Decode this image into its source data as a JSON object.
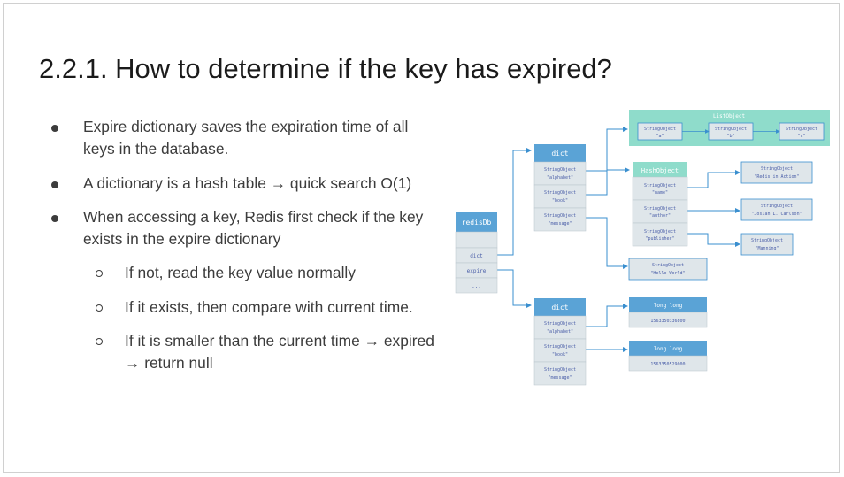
{
  "slide": {
    "title": "2.2.1. How to determine if the key has expired?"
  },
  "bullets": [
    {
      "level": 1,
      "lines": [
        "Expire dictionary saves the expiration time of all",
        "keys in the database."
      ]
    },
    {
      "level": 1,
      "lines": [
        "A dictionary is a hash table → quick search O(1)"
      ]
    },
    {
      "level": 1,
      "lines": [
        "When accessing a key, Redis first check if the key",
        "exists in the expire dictionary"
      ]
    },
    {
      "level": 2,
      "lines": [
        "If not, read the key value normally"
      ]
    },
    {
      "level": 2,
      "lines": [
        "If it exists, then compare with current time."
      ]
    },
    {
      "level": 2,
      "lines": [
        "If it is smaller than the current time → expired",
        "→ return null"
      ]
    }
  ],
  "diagram": {
    "redisDb": {
      "header": "redisDb",
      "cells": [
        "...",
        "dict",
        "expire",
        "..."
      ]
    },
    "dict_main": {
      "header": "dict",
      "cells": [
        [
          "StringObject",
          "\"alphabet\""
        ],
        [
          "StringObject",
          "\"book\""
        ],
        [
          "StringObject",
          "\"message\""
        ]
      ]
    },
    "dict_expire": {
      "header": "dict",
      "cells": [
        [
          "StringObject",
          "\"alphabet\""
        ],
        [
          "StringObject",
          "\"book\""
        ],
        [
          "StringObject",
          "\"message\""
        ]
      ]
    },
    "list_object": {
      "header": "ListObject",
      "items": [
        [
          "StringObject",
          "\"a\""
        ],
        [
          "StringObject",
          "\"b\""
        ],
        [
          "StringObject",
          "\"c\""
        ]
      ]
    },
    "hash_object": {
      "header": "HashObject",
      "cells": [
        [
          "StringObject",
          "\"name\""
        ],
        [
          "StringObject",
          "\"author\""
        ],
        [
          "StringObject",
          "\"publisher\""
        ]
      ]
    },
    "hash_values": [
      [
        "StringObject",
        "\"Redis in Action\""
      ],
      [
        "StringObject",
        "\"Josiah L. Carlson\""
      ],
      [
        "StringObject",
        "\"Manning\""
      ]
    ],
    "string_value": [
      "StringObject",
      "\"Hello World\""
    ],
    "long_values": [
      {
        "header": "long long",
        "value": "1563350336800"
      },
      {
        "header": "long long",
        "value": "1563350529000"
      }
    ],
    "colors": {
      "header": "#5aa3d6",
      "cell": "#dfe6ea",
      "teal": "#8fdccb",
      "edge": "#3a8fcf",
      "text": "#4a5ea8"
    }
  }
}
